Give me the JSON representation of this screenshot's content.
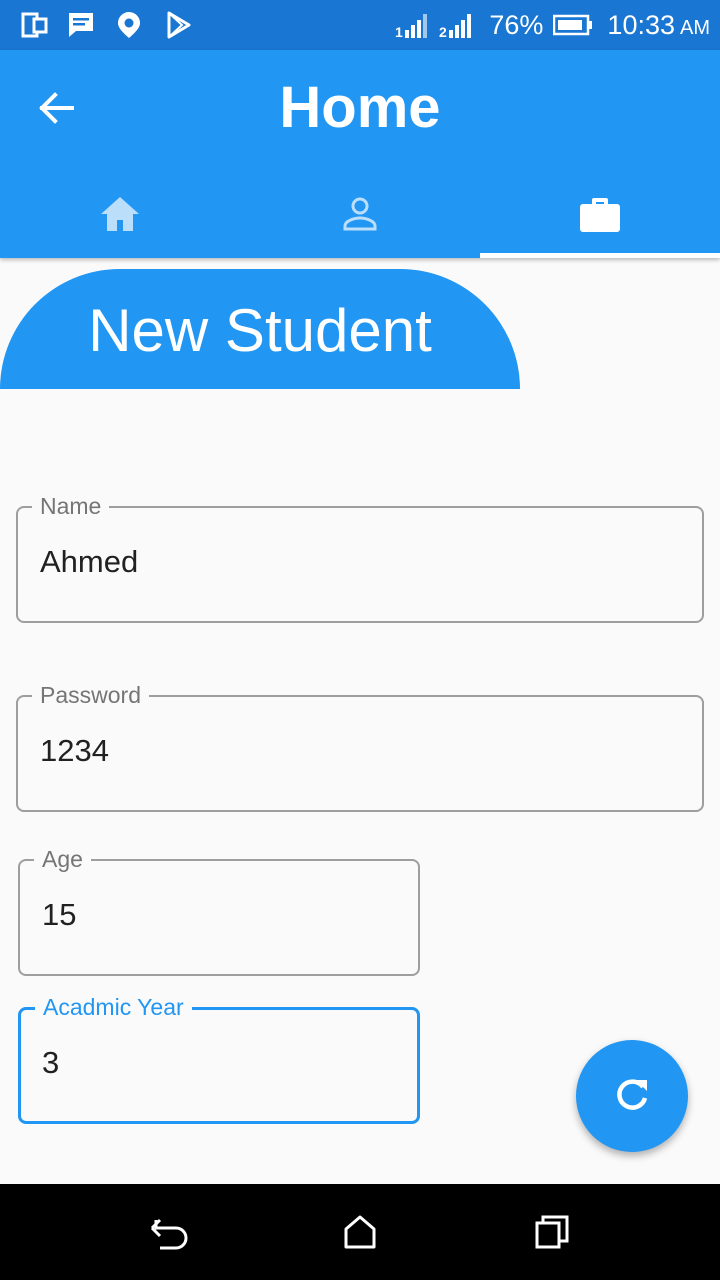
{
  "status_bar": {
    "battery_percent": "76%",
    "time": "10:33",
    "am_pm": "AM",
    "icons": [
      "phone-screen-icon",
      "message-icon",
      "location-pin-icon",
      "play-store-icon",
      "sim1-signal-icon",
      "sim2-signal-icon",
      "battery-icon"
    ]
  },
  "app_bar": {
    "title": "Home",
    "back_icon": "arrow-back-icon",
    "tabs": [
      {
        "icon": "home-icon",
        "active": false
      },
      {
        "icon": "person-icon",
        "active": false
      },
      {
        "icon": "briefcase-icon",
        "active": true
      }
    ]
  },
  "banner": {
    "title": "New Student"
  },
  "form": {
    "name": {
      "label": "Name",
      "value": "Ahmed"
    },
    "password": {
      "label": "Password",
      "value": "1234"
    },
    "age": {
      "label": "Age",
      "value": "15"
    },
    "academic_year": {
      "label": "Acadmic Year",
      "value": "3"
    }
  },
  "fab": {
    "icon": "refresh-icon"
  },
  "nav_bar": {
    "icons": [
      "back-nav-icon",
      "home-nav-icon",
      "recents-nav-icon"
    ]
  },
  "colors": {
    "primary": "#2196f3",
    "status_bar": "#1976d2",
    "background": "#fafafa"
  }
}
